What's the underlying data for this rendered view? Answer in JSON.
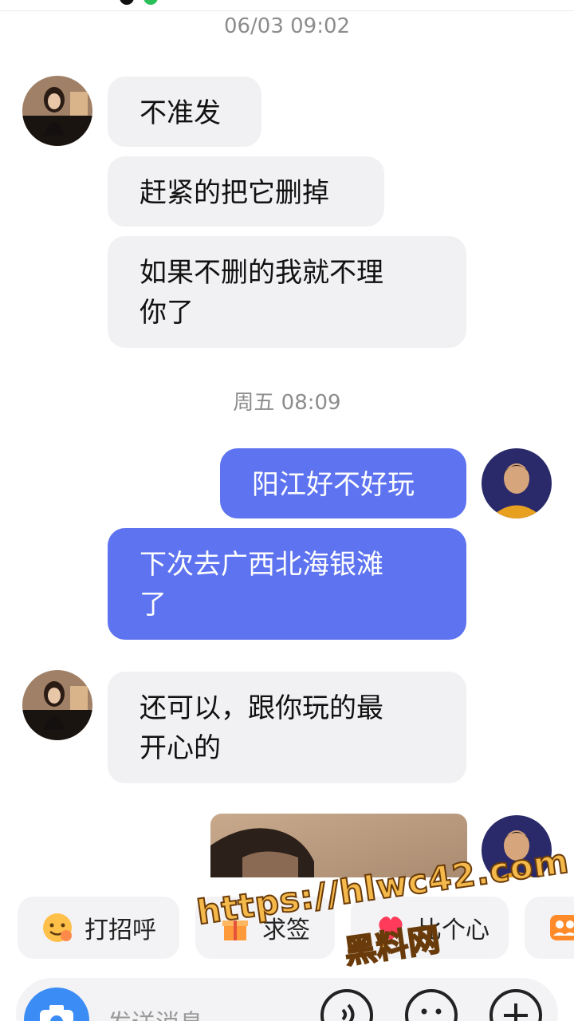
{
  "chat": {
    "timestamp_1": "06/03 09:02",
    "timestamp_2": "周五 08:09",
    "msg_1": "不准发",
    "msg_2": "赶紧的把它删掉",
    "msg_3_line1": "如果不删的我就不理",
    "msg_3_line2": "你了",
    "msg_4": "阳江好不好玩",
    "msg_5_line1": "下次去广西北海银滩",
    "msg_5_line2": "了",
    "msg_6_line1": "还可以，跟你玩的最",
    "msg_6_line2": "开心的"
  },
  "quick_actions": {
    "greet": "打招呼",
    "gift_partial": "求签",
    "heart_partial": "比个心"
  },
  "input": {
    "placeholder": "发送消息"
  },
  "watermark": {
    "url": "https://hlwc42.com",
    "name": "黑料网"
  },
  "colors": {
    "outgoing_bubble": "#5e73f0",
    "incoming_bubble": "#f1f1f3",
    "camera_button": "#3b8cf5"
  },
  "icons": [
    "camera-icon",
    "voice-icon",
    "emoji-icon",
    "plus-icon",
    "wave-emoji-icon",
    "gift-icon",
    "heart-icon",
    "group-icon"
  ]
}
